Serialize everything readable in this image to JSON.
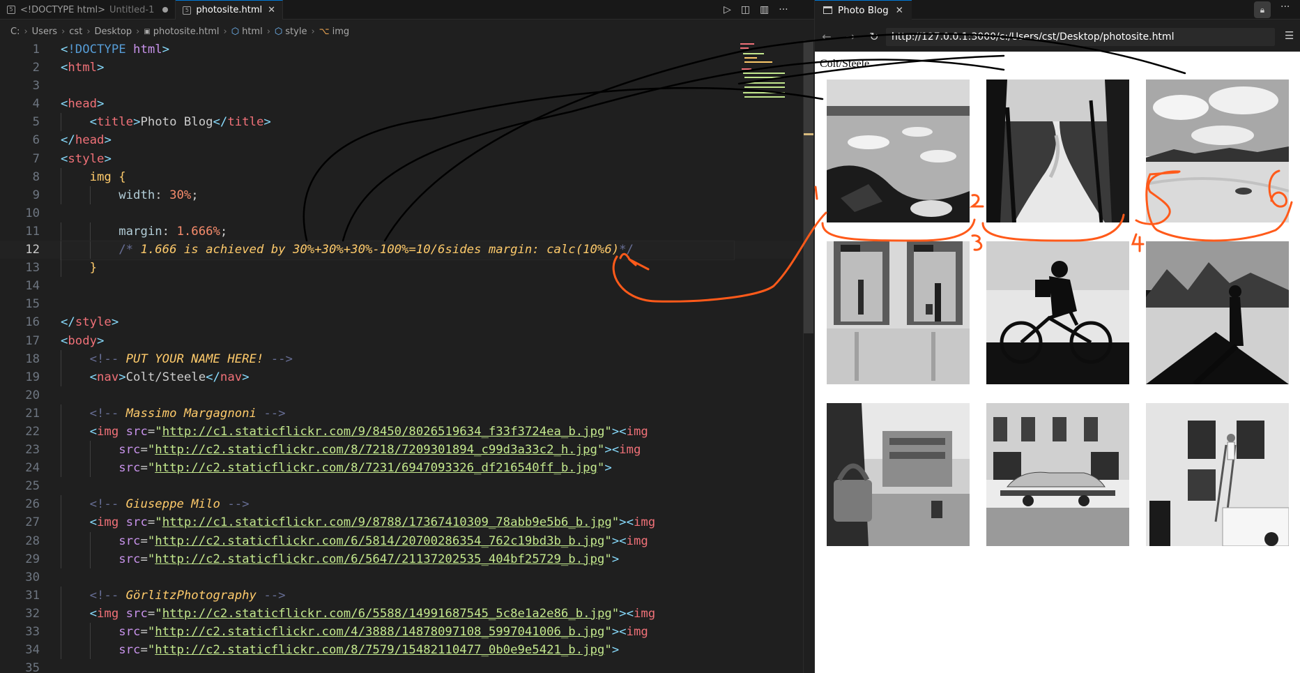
{
  "editor": {
    "tabs": [
      {
        "label": "<!DOCTYPE html>",
        "sublabel": "Untitled-1",
        "icon": "html-file-icon",
        "dirty": true
      },
      {
        "label": "photosite.html",
        "icon": "html-file-icon",
        "active": true
      }
    ],
    "breadcrumb": [
      {
        "label": "C:"
      },
      {
        "label": "Users"
      },
      {
        "label": "cst"
      },
      {
        "label": "Desktop"
      },
      {
        "label": "photosite.html",
        "icon": "html-file-icon"
      },
      {
        "label": "html",
        "icon": "cube-icon"
      },
      {
        "label": "style",
        "icon": "cube-icon"
      },
      {
        "label": "img",
        "icon": "tag-icon"
      }
    ],
    "current_line": 12,
    "lines": [
      {
        "n": "1",
        "text": "<!DOCTYPE html>"
      },
      {
        "n": "2",
        "text": "<html>"
      },
      {
        "n": "3",
        "text": ""
      },
      {
        "n": "4",
        "text": "<head>"
      },
      {
        "n": "5",
        "text": "    <title>Photo Blog</title>"
      },
      {
        "n": "6",
        "text": "</head>"
      },
      {
        "n": "7",
        "text": "<style>"
      },
      {
        "n": "8",
        "text": "    img {"
      },
      {
        "n": "9",
        "text": "        width: 30%;"
      },
      {
        "n": "10",
        "text": ""
      },
      {
        "n": "11",
        "text": "        margin: 1.666%;"
      },
      {
        "n": "12",
        "text": "        /* 1.666 is achieved by 30%+30%+30%-100%=10/6sides margin: calc(10%6)*/"
      },
      {
        "n": "13",
        "text": "    }"
      },
      {
        "n": "14",
        "text": ""
      },
      {
        "n": "15",
        "text": ""
      },
      {
        "n": "16",
        "text": "</style>"
      },
      {
        "n": "17",
        "text": "<body>"
      },
      {
        "n": "18",
        "text": "    <!-- PUT YOUR NAME HERE! -->"
      },
      {
        "n": "19",
        "text": "    <nav>Colt/Steele</nav>"
      },
      {
        "n": "20",
        "text": ""
      },
      {
        "n": "21",
        "text": "    <!-- Massimo Margagnoni -->"
      },
      {
        "n": "22",
        "text": "    <img src=\"http://c1.staticflickr.com/9/8450/8026519634_f33f3724ea_b.jpg\"><img"
      },
      {
        "n": "23",
        "text": "        src=\"http://c2.staticflickr.com/8/7218/7209301894_c99d3a33c2_h.jpg\"><img"
      },
      {
        "n": "24",
        "text": "        src=\"http://c2.staticflickr.com/8/7231/6947093326_df216540ff_b.jpg\">"
      },
      {
        "n": "25",
        "text": ""
      },
      {
        "n": "26",
        "text": "    <!-- Giuseppe Milo -->"
      },
      {
        "n": "27",
        "text": "    <img src=\"http://c1.staticflickr.com/9/8788/17367410309_78abb9e5b6_b.jpg\"><img"
      },
      {
        "n": "28",
        "text": "        src=\"http://c2.staticflickr.com/6/5814/20700286354_762c19bd3b_b.jpg\"><img"
      },
      {
        "n": "29",
        "text": "        src=\"http://c2.staticflickr.com/6/5647/21137202535_404bf25729_b.jpg\">"
      },
      {
        "n": "30",
        "text": ""
      },
      {
        "n": "31",
        "text": "    <!-- GörlitzPhotography -->"
      },
      {
        "n": "32",
        "text": "    <img src=\"http://c2.staticflickr.com/6/5588/14991687545_5c8e1a2e86_b.jpg\"><img"
      },
      {
        "n": "33",
        "text": "        src=\"http://c2.staticflickr.com/4/3888/14878097108_5997041006_b.jpg\"><img"
      },
      {
        "n": "34",
        "text": "        src=\"http://c2.staticflickr.com/8/7579/15482110477_0b0e9e5421_b.jpg\">"
      },
      {
        "n": "35",
        "text": ""
      }
    ],
    "actions": [
      "run-icon",
      "split-preview-icon",
      "split-editor-icon",
      "more-icon"
    ]
  },
  "preview": {
    "tab_label": "Photo Blog",
    "url": "http://127.0.0.1:3000/c:/Users/cst/Desktop/photosite.html",
    "nav_text": "Colt/Steele",
    "photos": [
      {
        "name": "photo-icebergs",
        "subject": "black-and-white lake with ice blocks"
      },
      {
        "name": "photo-waterfall",
        "subject": "black-and-white forest waterfall"
      },
      {
        "name": "photo-desert",
        "subject": "black-and-white dunes and sky"
      },
      {
        "name": "photo-elevators",
        "subject": "black-and-white station elevators"
      },
      {
        "name": "photo-cyclist",
        "subject": "black-and-white cyclist silhouette"
      },
      {
        "name": "photo-walker",
        "subject": "black-and-white walker shadow"
      },
      {
        "name": "photo-padlock",
        "subject": "black-and-white padlock on square"
      },
      {
        "name": "photo-car-trailer",
        "subject": "black-and-white car on trailer"
      },
      {
        "name": "photo-ladder",
        "subject": "black-and-white man on ladder"
      }
    ]
  },
  "annotations": {
    "labels": [
      "1",
      "2",
      "3",
      "4",
      "5",
      "6"
    ],
    "colors": {
      "orange": "#ff5a1a",
      "black": "#000000"
    }
  },
  "colors": {
    "editor_bg": "#1f1f1f",
    "accent": "#0078d4"
  }
}
